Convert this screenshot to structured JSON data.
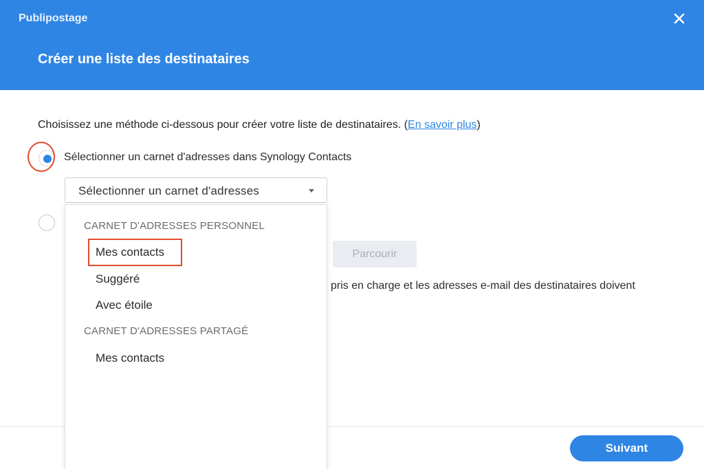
{
  "header": {
    "app_title": "Publipostage",
    "dialog_title": "Créer une liste des destinataires",
    "close_icon": "close-icon"
  },
  "body": {
    "instruction_prefix": "Choisissez une méthode ci-dessous pour créer votre liste de destinataires. (",
    "instruction_link": "En savoir plus",
    "instruction_suffix": ")",
    "option1_label": "Sélectionner un carnet d'adresses dans Synology Contacts",
    "option1_selected": true,
    "option2_selected": false,
    "select_value": "Sélectionner un carnet d'adresses",
    "browse_label": "Parcourir",
    "note_text": "pris en charge et les adresses e-mail des destinataires doivent"
  },
  "dropdown": {
    "groups": [
      {
        "header": "CARNET D'ADRESSES PERSONNEL",
        "items": [
          "Mes contacts",
          "Suggéré",
          "Avec étoile"
        ]
      },
      {
        "header": "CARNET D'ADRESSES PARTAGÉ",
        "items": [
          "Mes contacts"
        ]
      }
    ]
  },
  "footer": {
    "next_label": "Suivant"
  },
  "colors": {
    "accent": "#2f85e4",
    "highlight": "#e24a2e"
  }
}
